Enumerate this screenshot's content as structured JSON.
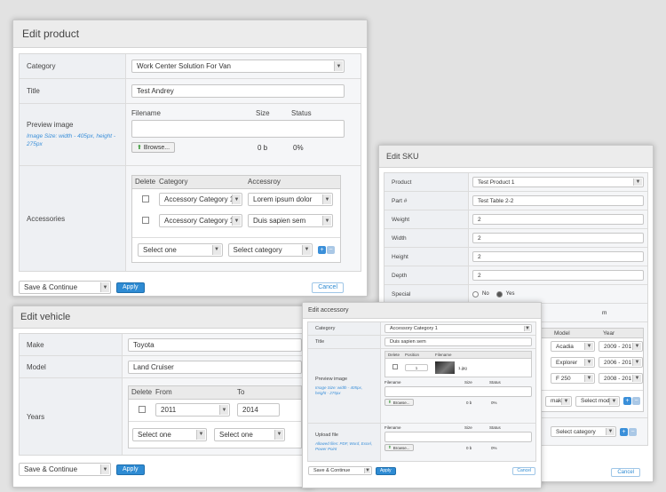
{
  "product": {
    "title": "Edit product",
    "category_label": "Category",
    "category_value": "Work Center Solution For Van",
    "title_label": "Title",
    "title_value": "Test Andrey",
    "preview_label": "Preview image",
    "preview_hint": "Image Size: width - 405px, height - 275px",
    "file_headers": [
      "Filename",
      "Size",
      "Status"
    ],
    "browse_label": "Browse...",
    "size_value": "0 b",
    "status_value": "0%",
    "accessories_label": "Accessories",
    "acc_headers": [
      "Delete",
      "Category",
      "Accessroy"
    ],
    "acc_rows": [
      {
        "category": "Accessory Category 1",
        "accessory": "Lorem ipsum dolor"
      },
      {
        "category": "Accessory Category 1",
        "accessory": "Duis sapien sem"
      }
    ],
    "acc_select_one": "Select one",
    "acc_select_category": "Select category",
    "footer_select": "Save & Continue",
    "apply": "Apply",
    "cancel": "Cancel"
  },
  "sku": {
    "title": "Edit SKU",
    "rows": [
      {
        "label": "Product",
        "value": "Test Product 1",
        "type": "select"
      },
      {
        "label": "Part #",
        "value": "Test Table 2-2",
        "type": "input"
      },
      {
        "label": "Weight",
        "value": "2",
        "type": "input"
      },
      {
        "label": "Width",
        "value": "2",
        "type": "input"
      },
      {
        "label": "Height",
        "value": "2",
        "type": "input"
      },
      {
        "label": "Depth",
        "value": "2",
        "type": "input"
      }
    ],
    "special_label": "Special",
    "special_no": "No",
    "special_yes": "Yes",
    "partial_text": "m",
    "model_header": "Model",
    "year_header": "Year",
    "models": [
      {
        "model": "Acadia",
        "year": "2009 - 201"
      },
      {
        "model": "Explorer",
        "year": "2006 - 201"
      },
      {
        "model": "F 250",
        "year": "2008 - 201"
      }
    ],
    "select_mak": "mak",
    "select_mod": "Select mod",
    "select_category": "Select category",
    "cancel": "Cancel"
  },
  "vehicle": {
    "title": "Edit vehicle",
    "make_label": "Make",
    "make_value": "Toyota",
    "model_label": "Model",
    "model_value": "Land Cruiser",
    "years_label": "Years",
    "years_headers": [
      "Delete",
      "From",
      "To"
    ],
    "from_value": "2011",
    "to_value": "2014",
    "select_one_a": "Select one",
    "select_one_b": "Select one",
    "footer_select": "Save & Continue",
    "apply": "Apply"
  },
  "accessory": {
    "title": "Edit accessory",
    "category_label": "Category",
    "category_value": "Accessory Category 1",
    "title_label": "Title",
    "title_value": "Duis sapien sem",
    "preview_label": "Preview image",
    "preview_hint": "Image Size: width - 405px, height - 275px",
    "preview_headers": [
      "Delete",
      "Position",
      "Filename"
    ],
    "position_value": "1",
    "filename_value": "1.jpg",
    "file_headers": [
      "Filename",
      "Size",
      "Status"
    ],
    "browse_label": "Browse...",
    "size_value": "0 b",
    "status_value": "0%",
    "upload_label": "Upload file",
    "upload_hint": "Allowed files: PDF, Word, Excel, Power Point",
    "footer_select": "Save & Continue",
    "apply": "Apply",
    "cancel": "Cancel"
  }
}
